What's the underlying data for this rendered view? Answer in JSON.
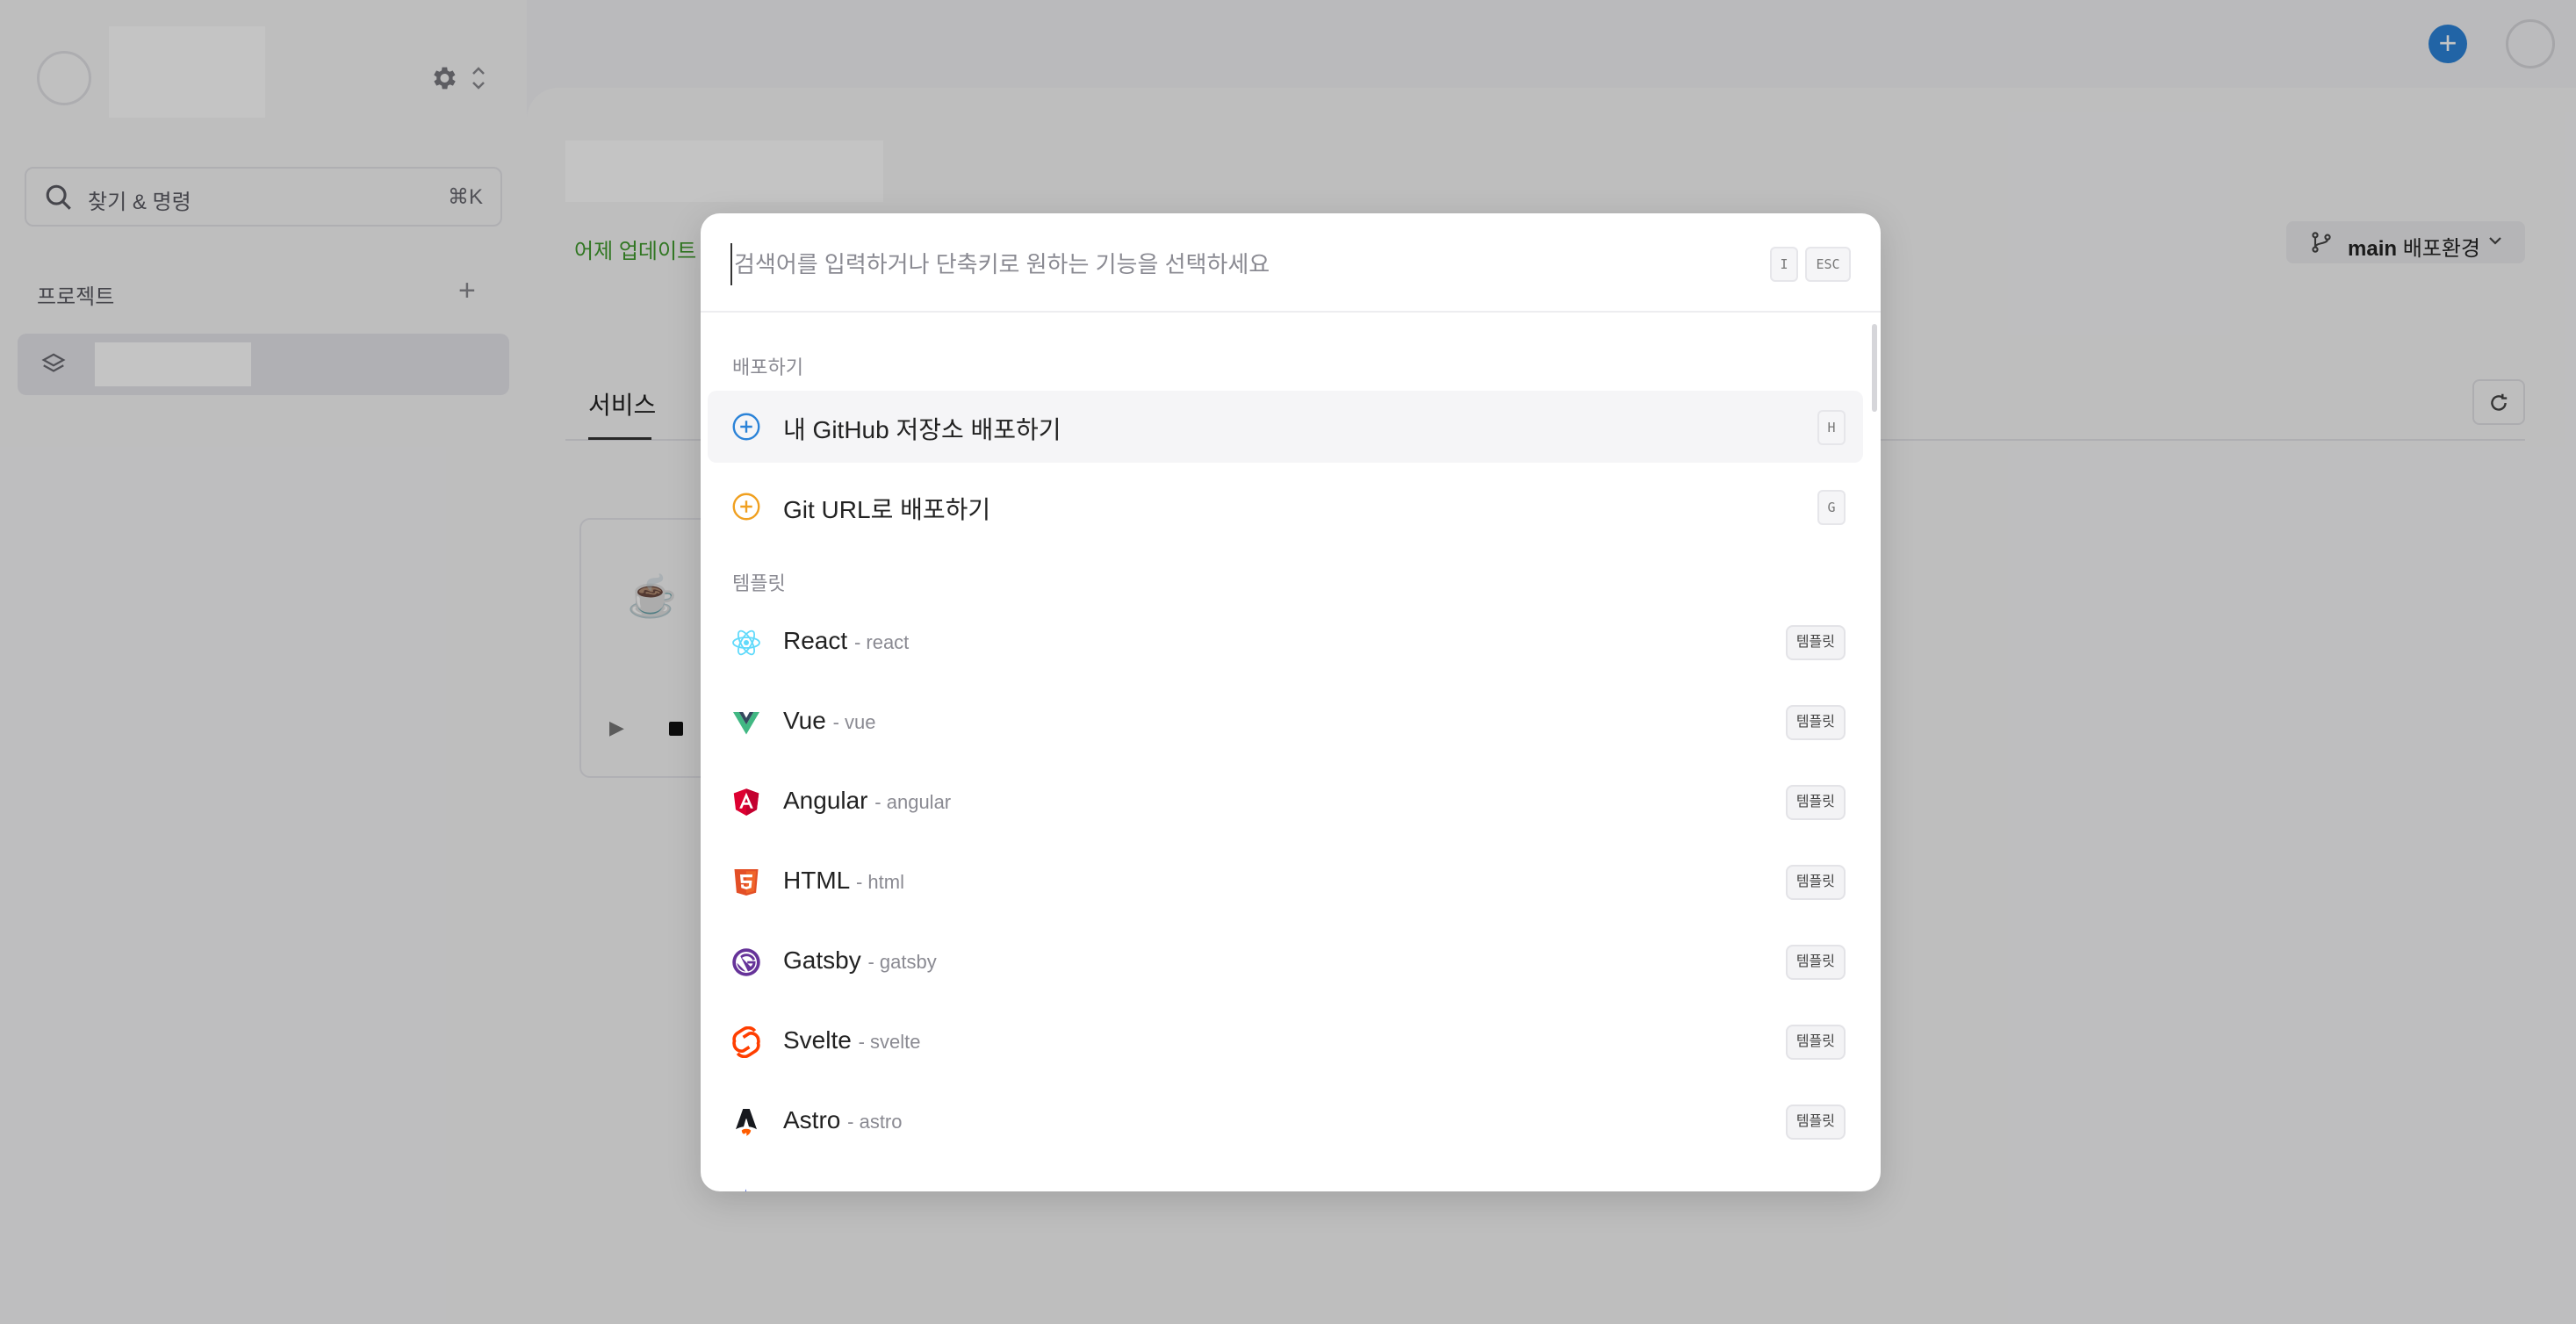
{
  "sidebar": {
    "search": {
      "label": "찾기 & 명령",
      "shortcut": "⌘K"
    },
    "projects_title": "프로젝트"
  },
  "main": {
    "updated_text": "어제 업데이트 됨",
    "branch": {
      "name": "main",
      "env_label": "배포환경"
    },
    "tabs": [
      {
        "label": "서비스"
      }
    ]
  },
  "palette": {
    "search_placeholder": "검색어를 입력하거나 단축키로 원하는 기능을 선택하세요",
    "shortcut_i": "I",
    "shortcut_esc": "ESC",
    "sections": [
      {
        "label": "배포하기",
        "items": [
          {
            "label": "내 GitHub 저장소 배포하기",
            "key": "H",
            "icon": "plus-circle-blue-icon"
          },
          {
            "label": "Git URL로 배포하기",
            "key": "G",
            "icon": "plus-circle-orange-icon"
          }
        ]
      },
      {
        "label": "템플릿",
        "items": [
          {
            "label": "React",
            "slug": "- react",
            "badge": "템플릿",
            "icon": "react-icon"
          },
          {
            "label": "Vue",
            "slug": "- vue",
            "badge": "템플릿",
            "icon": "vue-icon"
          },
          {
            "label": "Angular",
            "slug": "- angular",
            "badge": "템플릿",
            "icon": "angular-icon"
          },
          {
            "label": "HTML",
            "slug": "- html",
            "badge": "템플릿",
            "icon": "html5-icon"
          },
          {
            "label": "Gatsby",
            "slug": "- gatsby",
            "badge": "템플릿",
            "icon": "gatsby-icon"
          },
          {
            "label": "Svelte",
            "slug": "- svelte",
            "badge": "템플릿",
            "icon": "svelte-icon"
          },
          {
            "label": "Astro",
            "slug": "- astro",
            "badge": "템플릿",
            "icon": "astro-icon"
          }
        ]
      }
    ]
  },
  "colors": {
    "accent_blue": "#2b83d8",
    "updated_green": "#3f9a2c",
    "react": "#61dafb",
    "vue_green": "#41b883",
    "vue_dark": "#34495e",
    "angular": "#dd0031",
    "html5": "#e34f26",
    "gatsby": "#663399",
    "svelte": "#ff3e00",
    "astro": "#17191e"
  }
}
